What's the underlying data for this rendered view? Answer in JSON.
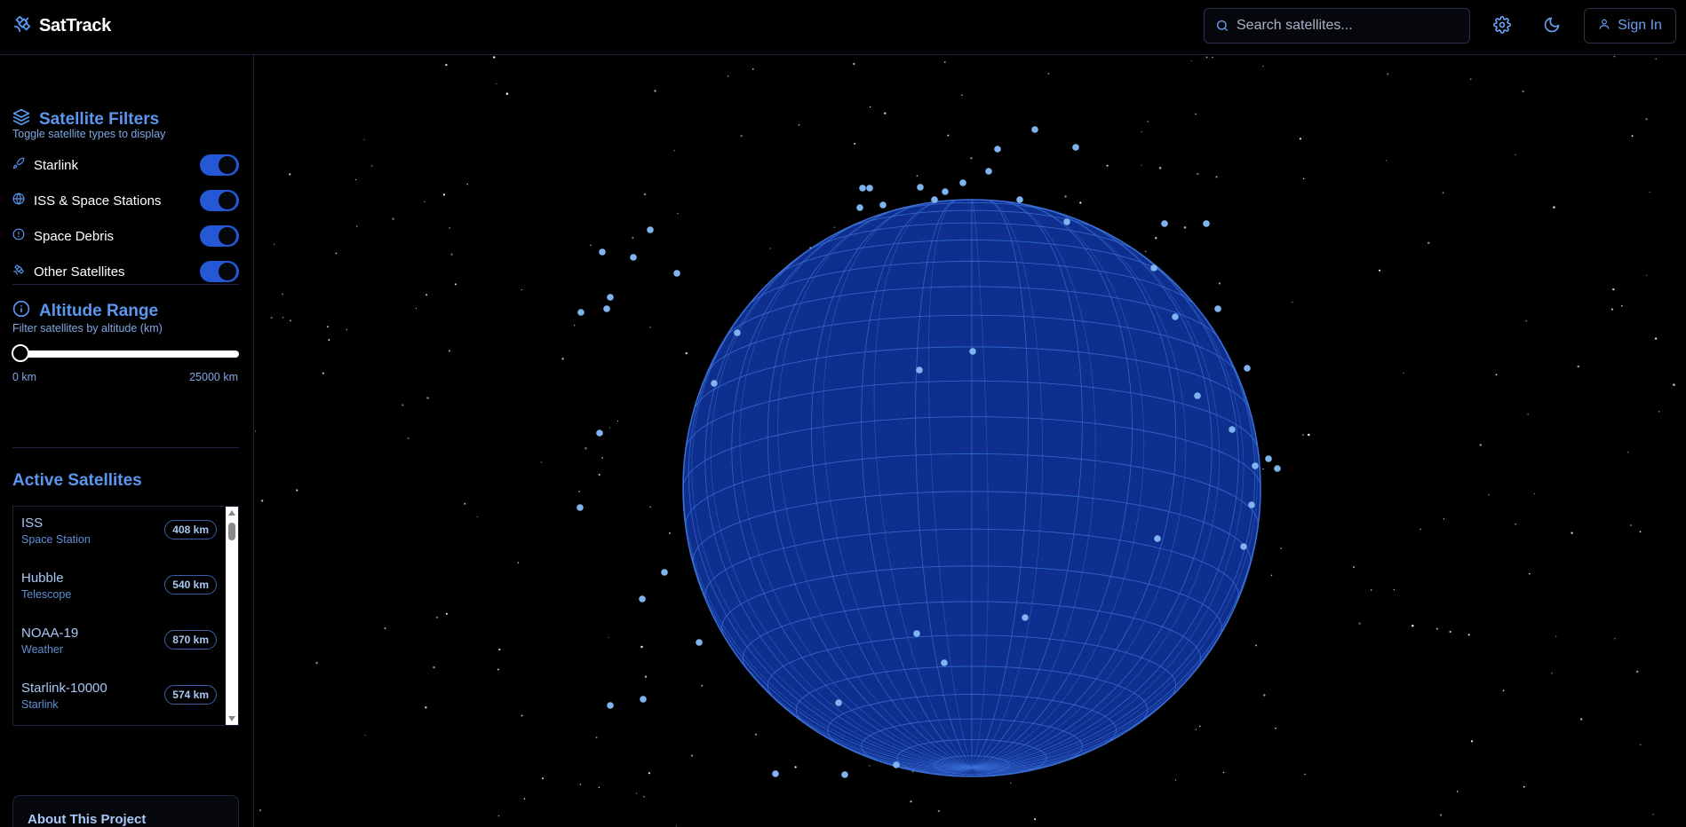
{
  "app": {
    "name": "SatTrack"
  },
  "header": {
    "search_placeholder": "Search satellites...",
    "sign_in_label": "Sign In"
  },
  "filters": {
    "title": "Satellite Filters",
    "subtitle": "Toggle satellite types to display",
    "items": [
      {
        "label": "Starlink",
        "icon": "rocket-icon",
        "enabled": true
      },
      {
        "label": "ISS & Space Stations",
        "icon": "globe-icon",
        "enabled": true
      },
      {
        "label": "Space Debris",
        "icon": "debris-icon",
        "enabled": true
      },
      {
        "label": "Other Satellites",
        "icon": "satellite-icon",
        "enabled": true
      }
    ]
  },
  "altitude": {
    "title": "Altitude Range",
    "subtitle": "Filter satellites by altitude (km)",
    "min_label": "0 km",
    "max_label": "25000 km",
    "value": 0
  },
  "active": {
    "title": "Active Satellites",
    "items": [
      {
        "name": "ISS",
        "type": "Space Station",
        "altitude": "408 km"
      },
      {
        "name": "Hubble",
        "type": "Telescope",
        "altitude": "540 km"
      },
      {
        "name": "NOAA-19",
        "type": "Weather",
        "altitude": "870 km"
      },
      {
        "name": "Starlink-10000",
        "type": "Starlink",
        "altitude": "574 km"
      }
    ]
  },
  "about": {
    "title": "About This Project"
  },
  "colors": {
    "accent": "#5b96ef",
    "toggle_on": "#2458d6",
    "globe": "#0f2f8f",
    "globe_grid": "#3a6fd8",
    "satellite_dot": "#7fb4f0"
  }
}
